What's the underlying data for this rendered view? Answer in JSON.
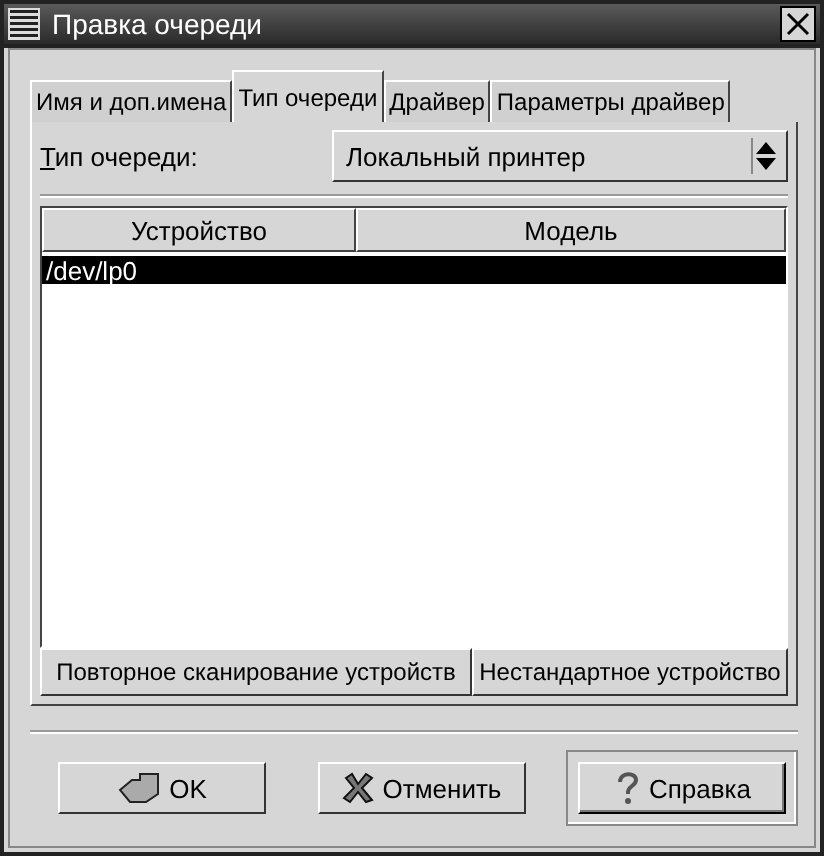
{
  "window": {
    "title": "Правка очереди"
  },
  "tabs": [
    {
      "label": "Имя и доп.имена",
      "selected": false
    },
    {
      "label": "Тип очереди",
      "selected": true
    },
    {
      "label": "Драйвер",
      "selected": false
    },
    {
      "label": "Параметры драйвер",
      "selected": false
    }
  ],
  "queue_type": {
    "label": "Тип очереди:",
    "value": "Локальный принтер"
  },
  "table": {
    "columns": [
      "Устройство",
      "Модель"
    ],
    "rows": [
      {
        "device": "/dev/lp0",
        "selected": true
      }
    ]
  },
  "table_buttons": [
    "Повторное сканирование устройств",
    "Нестандартное устройство"
  ],
  "buttons": [
    {
      "label": "OK",
      "kind": "ok",
      "default": false
    },
    {
      "label": "Отменить",
      "kind": "cancel",
      "default": false
    },
    {
      "label": "Справка",
      "kind": "help",
      "default": true
    }
  ]
}
